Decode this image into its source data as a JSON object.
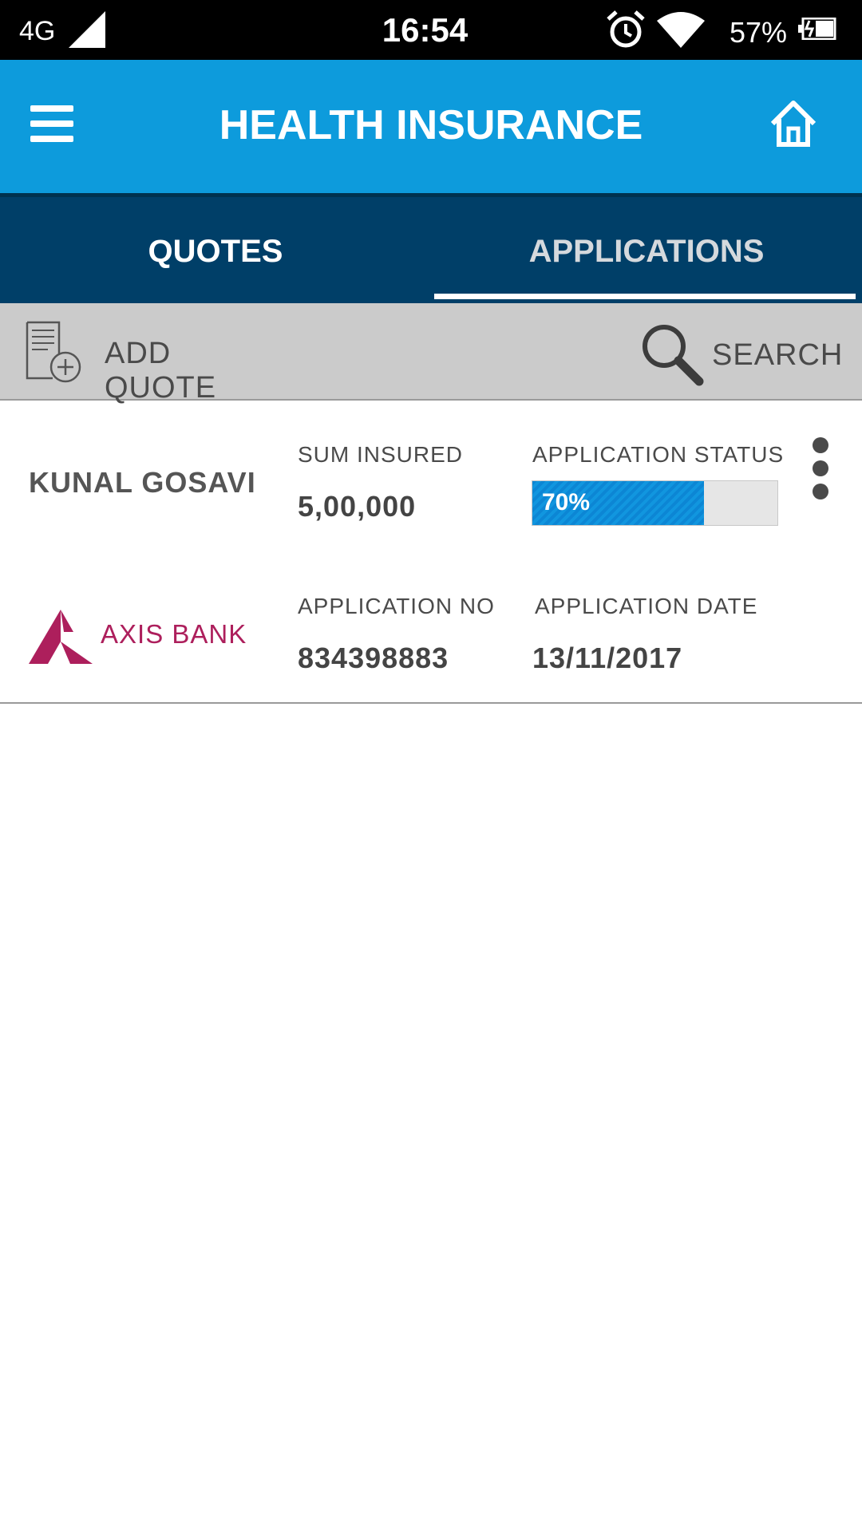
{
  "status_bar": {
    "network": "4G",
    "time": "16:54",
    "battery": "57%",
    "icons": [
      "signal-icon",
      "alarm-icon",
      "wifi-icon",
      "battery-icon"
    ]
  },
  "header": {
    "title": "HEALTH INSURANCE",
    "background": "#0d9bdc",
    "icons": [
      "menu-icon",
      "home-icon"
    ]
  },
  "tabs": {
    "items": [
      {
        "label": "QUOTES"
      },
      {
        "label": "APPLICATIONS",
        "selected": true
      }
    ],
    "background": "#003f68"
  },
  "toolbar": {
    "add_quote_label": "ADD QUOTE",
    "search_label": "SEARCH",
    "icons": [
      "add-quote-icon",
      "search-icon"
    ]
  },
  "applications": [
    {
      "customer_name": "KUNAL GOSAVI",
      "sum_insured_label": "SUM INSURED",
      "sum_insured": "5,00,000",
      "status_label": "APPLICATION STATUS",
      "status_percent_text": "70%",
      "status_progress": 0.7,
      "bank_name": "AXIS BANK",
      "application_no_label": "APPLICATION NO",
      "application_no": "834398883",
      "application_date_label": "APPLICATION DATE",
      "application_date": "13/11/2017"
    }
  ],
  "colors": {
    "progress_fill": "#0c86d4",
    "bank_brand": "#ad1f5c"
  }
}
